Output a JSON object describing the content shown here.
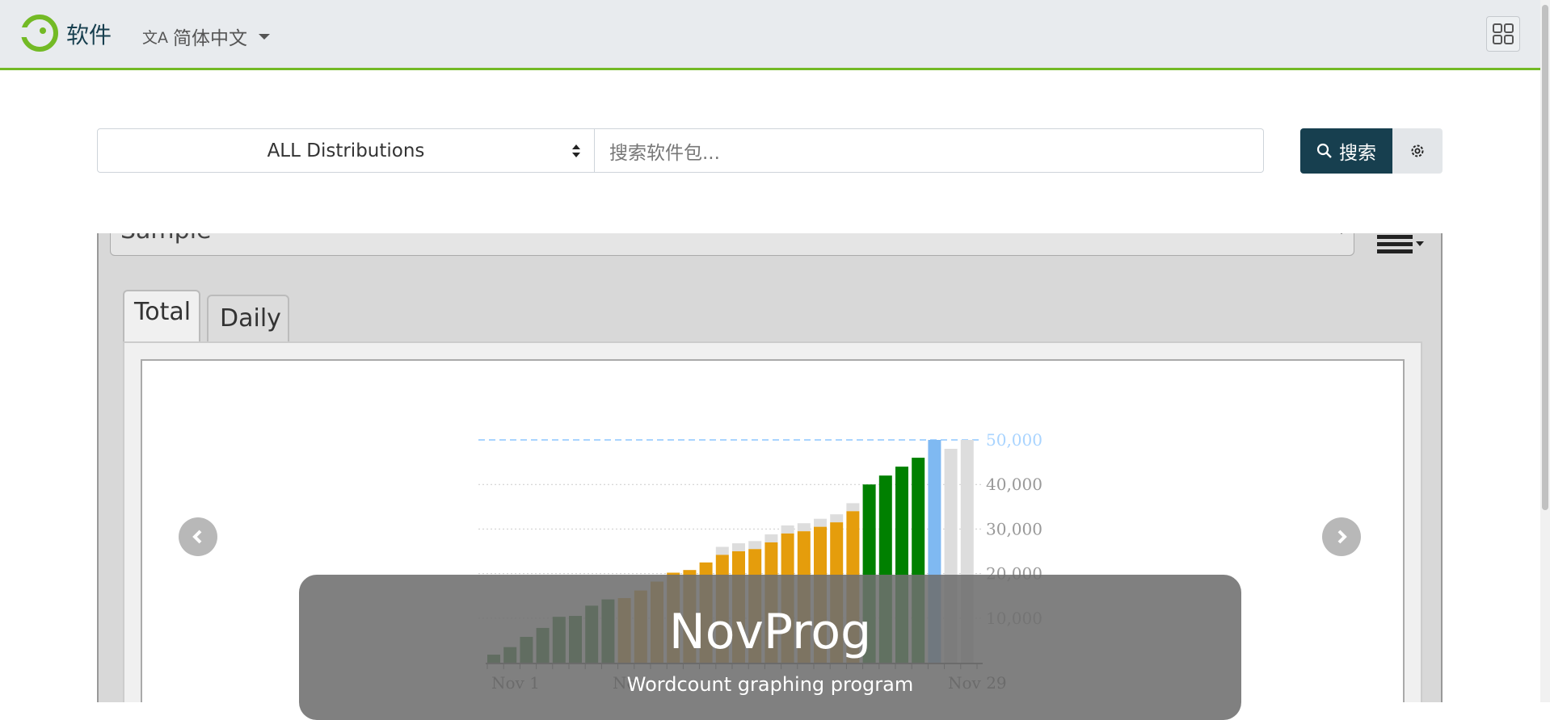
{
  "header": {
    "brand": "软件",
    "language": "简体中文",
    "icons": {
      "logo": "opensuse-logo-icon",
      "translate": "translate-icon",
      "apps": "apps-grid-icon"
    },
    "accent_color": "#73ba25",
    "brand_color": "#173f4f"
  },
  "search": {
    "distribution": "ALL Distributions",
    "placeholder": "搜索软件包...",
    "button_label": "搜索"
  },
  "screenshot": {
    "dropdown_label": "Sample",
    "tabs": [
      "Total",
      "Daily"
    ],
    "active_tab": "Total",
    "caption_title": "NovProg",
    "caption_subtitle": "Wordcount graphing program"
  },
  "chart_data": {
    "type": "bar",
    "target": 50000,
    "y_ticks": [
      "10,000",
      "20,000",
      "30,000",
      "40,000",
      "50,000"
    ],
    "x_labels": [
      "Nov 1",
      "Nov",
      "Nov 29"
    ],
    "values": [
      1800,
      3500,
      5800,
      7800,
      10300,
      10500,
      12800,
      14200,
      14500,
      16200,
      18200,
      20200,
      20800,
      22500,
      24200,
      25000,
      25500,
      27000,
      29000,
      29500,
      30500,
      31500,
      34000,
      40000,
      42000,
      44000,
      46000,
      50000,
      48000,
      50000
    ],
    "series_colors": {
      "dark_green": "#006400",
      "orange": "#e59d0c",
      "green": "#008000",
      "blue": "#7fb9f2",
      "grey": "#dddddd",
      "goal_line": "#a9d4ff"
    }
  }
}
